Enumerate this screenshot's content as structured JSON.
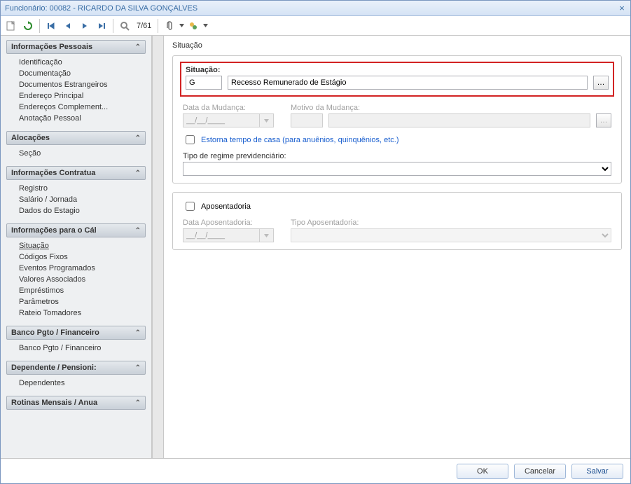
{
  "window": {
    "title": "Funcionário: 00082 - RICARDO DA SILVA GONÇALVES"
  },
  "toolbar": {
    "counter": "7/61"
  },
  "sidebar": {
    "groups": [
      {
        "title": "Informações Pessoais",
        "items": [
          "Identificação",
          "Documentação",
          "Documentos Estrangeiros",
          "Endereço Principal",
          "Endereços Complement...",
          "Anotação Pessoal"
        ]
      },
      {
        "title": "Alocações",
        "items": [
          "Seção"
        ]
      },
      {
        "title": "Informações Contratua",
        "items": [
          "Registro",
          "Salário / Jornada",
          "Dados do Estagio"
        ]
      },
      {
        "title": "Informações para o Cál",
        "items": [
          "Situação",
          "Códigos Fixos",
          "Eventos Programados",
          "Valores Associados",
          "Empréstimos",
          "Parâmetros",
          "Rateio Tomadores"
        ],
        "activeIndex": 0
      },
      {
        "title": "Banco Pgto / Financeiro",
        "items": [
          "Banco Pgto / Financeiro"
        ]
      },
      {
        "title": "Dependente / Pensioni:",
        "items": [
          "Dependentes"
        ]
      },
      {
        "title": "Rotinas Mensais / Anua",
        "items": []
      }
    ]
  },
  "main": {
    "title": "Situação",
    "situacao": {
      "label": "Situação:",
      "code": "G",
      "desc": "Recesso Remunerado de Estágio"
    },
    "data_mudanca": {
      "label": "Data da Mudança:",
      "value": "__/__/____"
    },
    "motivo_mudanca": {
      "label": "Motivo da Mudança:",
      "value": ""
    },
    "estorna_label": "Estorna tempo de casa (para anuênios, quinquênios, etc.)",
    "regime_label": "Tipo de regime previdenciário:",
    "regime_value": "",
    "aposentadoria": {
      "label": "Aposentadoria",
      "data_label": "Data Aposentadoria:",
      "data_value": "__/__/____",
      "tipo_label": "Tipo Aposentadoria:",
      "tipo_value": ""
    }
  },
  "footer": {
    "ok": "OK",
    "cancelar": "Cancelar",
    "salvar": "Salvar"
  }
}
